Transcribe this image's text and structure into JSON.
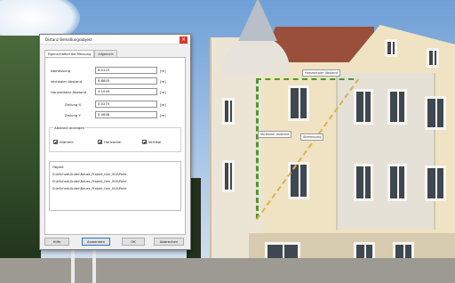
{
  "dialog": {
    "title": "Distanz Bemaßungsobjekt",
    "tabs": [
      {
        "label": "Eigenschaften der Messung"
      },
      {
        "label": "Allgemein"
      }
    ],
    "fields": [
      {
        "label": "Abmessung",
        "value": "8.0125",
        "unit": "[m]"
      },
      {
        "label": "Vertikaler Abstand",
        "value": "6.8805",
        "unit": "[m]"
      },
      {
        "label": "Horizontaler Abstand",
        "value": "4.1049",
        "unit": "[m]"
      },
      {
        "label": "Zeilung X",
        "value": "0.0275",
        "unit": "[m]"
      },
      {
        "label": "Zeilung Y",
        "value": "0.0608",
        "unit": "[m]"
      }
    ],
    "group": {
      "title": "Abstand anzeigen",
      "options": [
        {
          "label": "Diametr.",
          "checked": true
        },
        {
          "label": "Horizontal",
          "checked": true
        },
        {
          "label": "Vertikal",
          "checked": true
        }
      ]
    },
    "list": {
      "header": "Objekt",
      "lines": [
        "D:\\eScholz\\Guder\\Neues_Projekt_Gen_004\\Point",
        "D:\\eScholz\\Guder\\Neues_Projekt_Gen_004\\Point",
        "D:\\eScholz\\Guder\\Neues_Projekt_Gen_004\\Point"
      ]
    },
    "buttons": {
      "help": "Hilfe",
      "apply": "Anwenden",
      "ok": "OK",
      "cancel": "Abbrechen"
    }
  },
  "measurements": {
    "top_label": "Horizontaler Abstand",
    "middle_label": "Vertikaler Abstand",
    "right_label": "Abmessung"
  },
  "colors": {
    "close_button": "#d9372b",
    "measure_line_green": "#4c9a2a",
    "measure_line_yellow": "#d9b24a"
  },
  "icons": {
    "close": "close-icon",
    "checkbox": "checkbox-checked-icon"
  }
}
